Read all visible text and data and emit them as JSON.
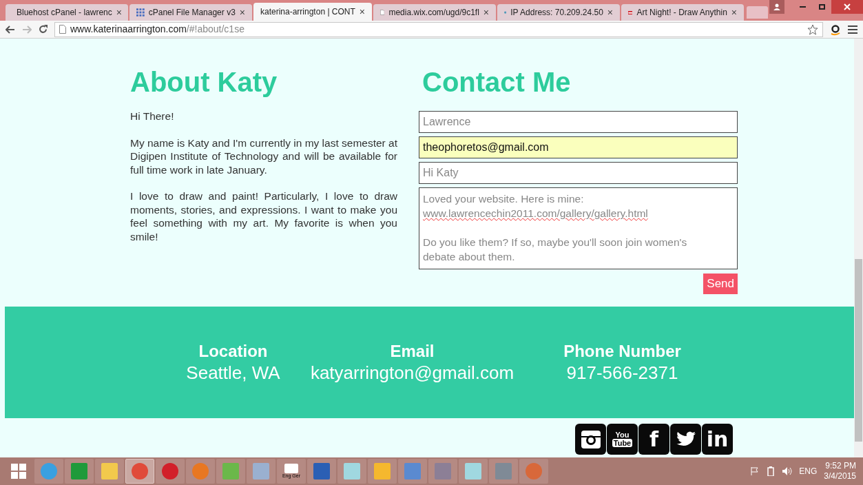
{
  "browser": {
    "tabs": [
      {
        "title": "Bluehost cPanel - lawrenc",
        "selected": false
      },
      {
        "title": "cPanel File Manager v3",
        "selected": false
      },
      {
        "title": "katerina-arrington | CONT",
        "selected": true
      },
      {
        "title": "media.wix.com/ugd/9c1fl",
        "selected": false
      },
      {
        "title": "IP Address: 70.209.24.50",
        "selected": false
      },
      {
        "title": "Art Night! - Draw Anythin",
        "selected": false
      }
    ],
    "tab_close": "×",
    "url_host": "www.katerinaarrington.com",
    "url_path": "/#!about/c1se"
  },
  "about": {
    "heading": "About Katy",
    "paragraphs": [
      "Hi There!",
      "My name is Katy and I'm currently in my last semester at Digipen Institute of Technology and will be available for full time work in late January.",
      "I love to draw and paint! Particularly, I love to draw moments, stories, and expressions. I want to make you feel something with my art. My favorite is when you smile!"
    ]
  },
  "contact": {
    "heading": "Contact Me",
    "name_field": {
      "value": "Lawrence",
      "autofilled": false
    },
    "email_field": {
      "value": "theophoretos@gmail.com",
      "autofilled": true
    },
    "subject_field": {
      "value": "Hi Katy",
      "autofilled": false
    },
    "message_paragraphs": [
      [
        "Loved your website. Here is mine:",
        "www.lawrencechin2011.com/gallery/gallery.html"
      ],
      [
        "Do you like them? If so, maybe you'll soon join women's",
        "debate about them."
      ]
    ],
    "send_button": "Send"
  },
  "footer": [
    {
      "label": "Location",
      "value": "Seattle, WA"
    },
    {
      "label": "Email",
      "value": "katyarrington@gmail.com"
    },
    {
      "label": "Phone Number",
      "value": "917-566-2371"
    }
  ],
  "social": [
    {
      "kind": "camera"
    },
    {
      "kind": "text",
      "glyph": "You",
      "glyph2": "Tube"
    },
    {
      "kind": "text",
      "glyph": "f"
    },
    {
      "kind": "bird"
    },
    {
      "kind": "text",
      "glyph": "in"
    }
  ],
  "taskbar": {
    "items": [
      {
        "kind": "ie",
        "selected": false
      },
      {
        "kind": "store",
        "selected": false
      },
      {
        "kind": "folder",
        "selected": false
      },
      {
        "kind": "chrome",
        "selected": true
      },
      {
        "kind": "opera",
        "selected": false
      },
      {
        "kind": "firefox",
        "selected": false
      },
      {
        "kind": "people",
        "selected": false
      },
      {
        "kind": "paint",
        "selected": false
      },
      {
        "kind": "dictionary",
        "label": "Eng Ger",
        "selected": false
      },
      {
        "kind": "word",
        "selected": false
      },
      {
        "kind": "notepad",
        "selected": false
      },
      {
        "kind": "archive",
        "selected": false
      },
      {
        "kind": "document",
        "selected": false
      },
      {
        "kind": "panel",
        "selected": false
      },
      {
        "kind": "notepad",
        "selected": false
      },
      {
        "kind": "photo",
        "selected": false
      },
      {
        "kind": "pie",
        "selected": false
      }
    ],
    "language": "ENG",
    "time": "9:52 PM",
    "date": "3/4/2015"
  }
}
